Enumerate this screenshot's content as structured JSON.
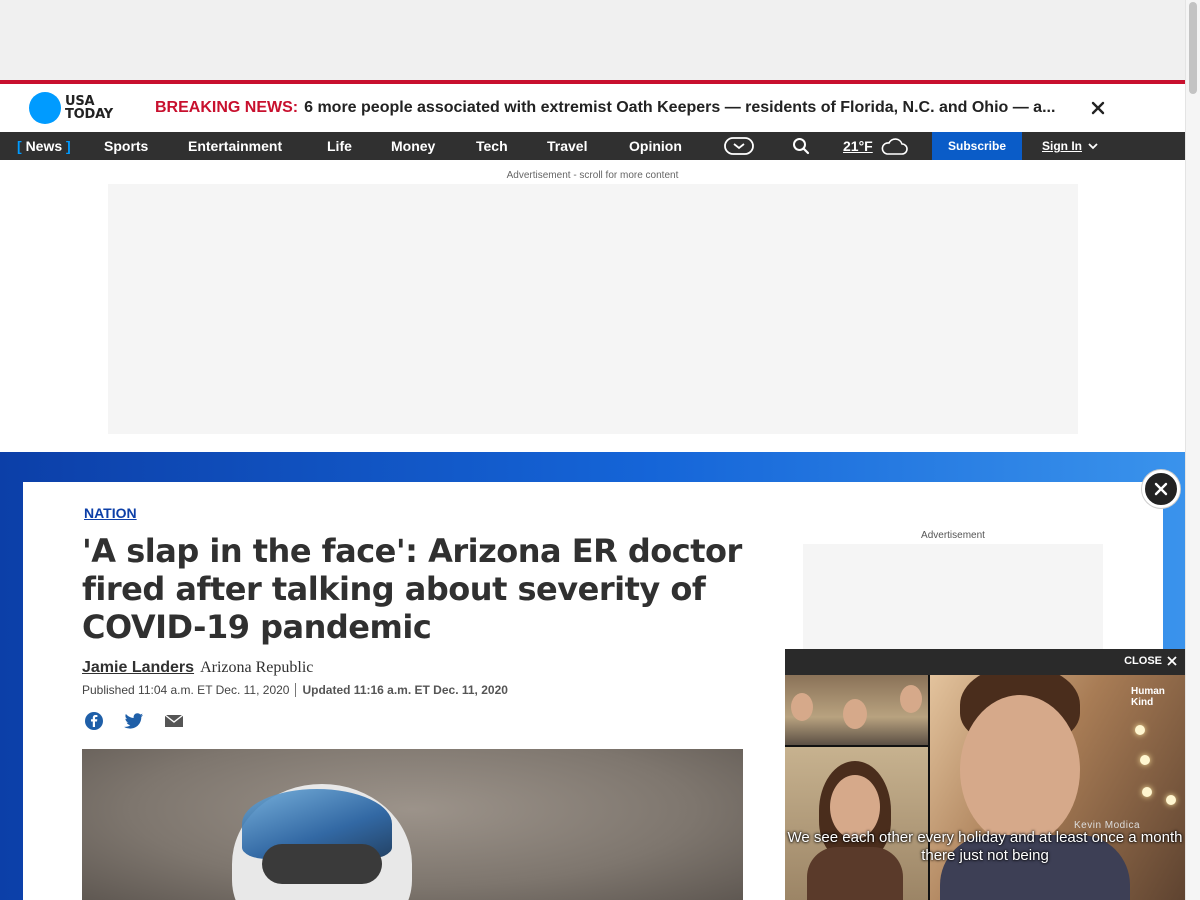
{
  "brand": {
    "logo_line1": "USA",
    "logo_line2": "TODAY",
    "logo_color": "#009bff"
  },
  "breaking": {
    "label": "BREAKING NEWS:",
    "text": "6 more people associated with extremist Oath Keepers — residents of Florida, N.C. and Ohio — a...",
    "close_icon": "close-icon",
    "accent": "#c8102e"
  },
  "nav": {
    "items": [
      {
        "label": "News",
        "active": true
      },
      {
        "label": "Sports"
      },
      {
        "label": "Entertainment"
      },
      {
        "label": "Life"
      },
      {
        "label": "Money"
      },
      {
        "label": "Tech"
      },
      {
        "label": "Travel"
      },
      {
        "label": "Opinion"
      }
    ],
    "bracket_open": "[",
    "bracket_close": "]",
    "temperature": "21°F",
    "subscribe_label": "Subscribe",
    "signin_label": "Sign In",
    "subscribe_color": "#0a5cc8"
  },
  "ads": {
    "top_label": "Advertisement - scroll for more content",
    "right_label": "Advertisement"
  },
  "article": {
    "section": "NATION",
    "headline": "'A slap in the face': Arizona ER doctor fired after talking about severity of COVID-19 pandemic",
    "author": "Jamie Landers",
    "outlet": "Arizona Republic",
    "published": "Published 11:04 a.m. ET Dec. 11, 2020",
    "updated": "Updated 11:16 a.m. ET Dec. 11, 2020"
  },
  "video": {
    "close_label": "CLOSE",
    "caption": "We see each other every holiday and at least once a month there just not being",
    "speaker_name": "Kevin Modica",
    "brand_line1": "Human",
    "brand_line2": "Kind"
  }
}
